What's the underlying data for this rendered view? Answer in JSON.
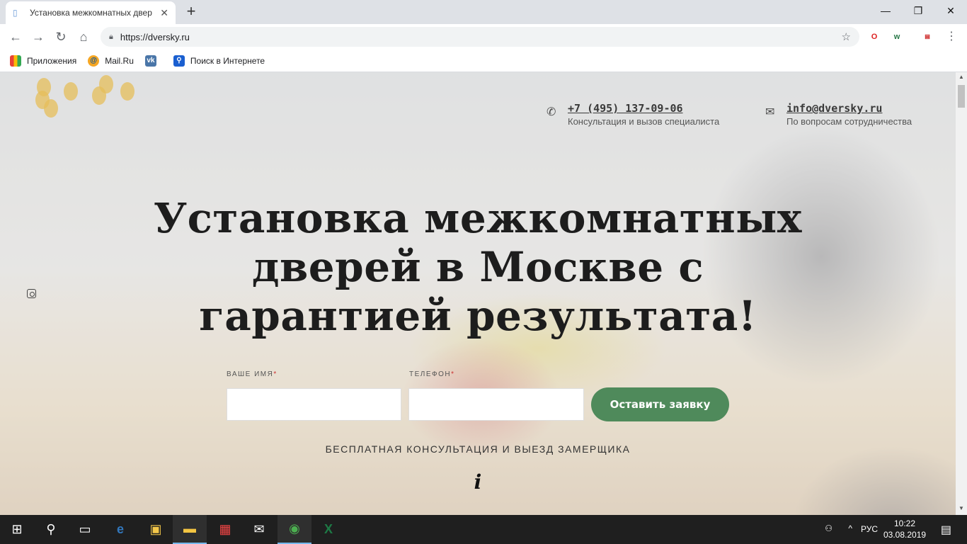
{
  "browser": {
    "tab_title": "Установка межкомнатных двер",
    "tab_favicon": "document-icon",
    "url": "https://dversky.ru",
    "bookmarks": [
      {
        "label": "Приложения",
        "icon": "apps-grid-icon"
      },
      {
        "label": "Mail.Ru",
        "icon": "mailru-icon"
      },
      {
        "label": "",
        "icon": "vk-icon"
      },
      {
        "label": "Поиск в Интернете",
        "icon": "search-icon"
      }
    ]
  },
  "header": {
    "phone": {
      "number": "+7 (495) 137-09-06",
      "caption": "Консультация и вызов специалиста"
    },
    "email": {
      "address": "info@dversky.ru",
      "caption": "По вопросам сотрудничества"
    }
  },
  "hero": {
    "headline": "Установка межкомнатных дверей в Москве с гарантией результата!",
    "name_label": "ВАШЕ ИМЯ",
    "phone_label": "ТЕЛЕФОН",
    "required_mark": "*",
    "name_value": "",
    "phone_value": "",
    "submit_label": "Оставить заявку",
    "consult_text": "БЕСПЛАТНАЯ КОНСУЛЬТАЦИЯ И ВЫЕЗД ЗАМЕРЩИКА",
    "info_glyph": "i"
  },
  "taskbar": {
    "language": "РУС",
    "time": "10:22",
    "date": "03.08.2019"
  },
  "colors": {
    "submit_bg": "#4f8a5b",
    "tabstrip_bg": "#dee1e6",
    "taskbar_bg": "#1f1f1f"
  }
}
